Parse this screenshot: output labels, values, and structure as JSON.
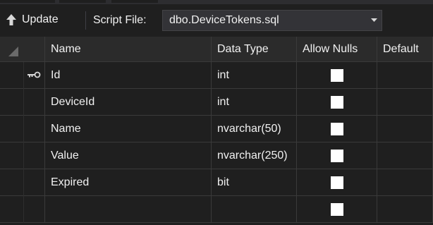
{
  "toolbar": {
    "update_label": "Update",
    "script_file_label": "Script File:",
    "script_file_value": "dbo.DeviceTokens.sql"
  },
  "grid": {
    "columns": [
      "Name",
      "Data Type",
      "Allow Nulls",
      "Default"
    ],
    "rows": [
      {
        "name": "Id",
        "type": "int",
        "allow_nulls": false,
        "primary_key": true
      },
      {
        "name": "DeviceId",
        "type": "int",
        "allow_nulls": false,
        "primary_key": false
      },
      {
        "name": "Name",
        "type": "nvarchar(50)",
        "allow_nulls": false,
        "primary_key": false
      },
      {
        "name": "Value",
        "type": "nvarchar(250)",
        "allow_nulls": false,
        "primary_key": false
      },
      {
        "name": "Expired",
        "type": "bit",
        "allow_nulls": false,
        "primary_key": false
      },
      {
        "name": "",
        "type": "",
        "allow_nulls": false,
        "primary_key": false
      }
    ]
  },
  "icons": {
    "update": "arrow-up-icon",
    "dropdown": "chevron-down-icon",
    "primary_key": "key-icon",
    "corner": "select-all-triangle-icon"
  },
  "colors": {
    "background": "#1f1f1f",
    "header": "#2b2b2b",
    "text": "#f1f1f1",
    "checkbox": "#ffffff"
  }
}
